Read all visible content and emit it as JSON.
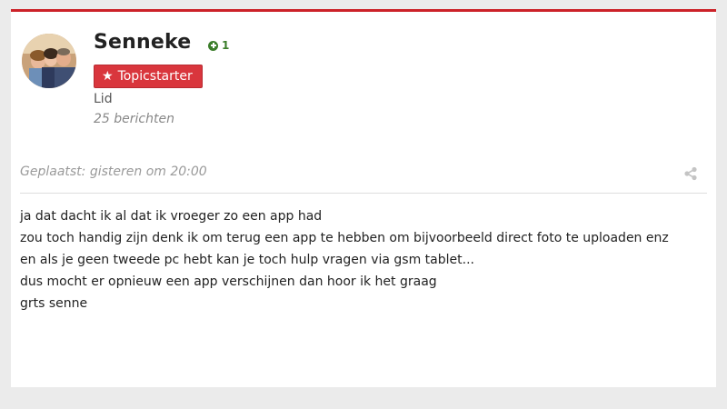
{
  "author": {
    "name": "Senneke",
    "reputation": "1",
    "badge": "Topicstarter",
    "role": "Lid",
    "post_count": "25 berichten"
  },
  "post": {
    "posted": "Geplaatst: gisteren om 20:00",
    "lines": [
      "ja dat dacht ik al dat ik vroeger zo een app had",
      "zou toch handig zijn denk ik om terug een app te hebben om bijvoorbeeld direct foto te uploaden enz",
      "en als je geen tweede pc hebt kan je toch hulp vragen via gsm tablet...",
      "dus mocht er opnieuw een app verschijnen dan hoor ik het graag",
      "grts senne"
    ]
  },
  "icons": {
    "reputation": "plus-circle-icon",
    "badge": "star-icon",
    "share": "share-icon"
  },
  "colors": {
    "accent": "#cc2229",
    "badge_bg": "#d9363d",
    "reputation": "#3b7d2a"
  }
}
